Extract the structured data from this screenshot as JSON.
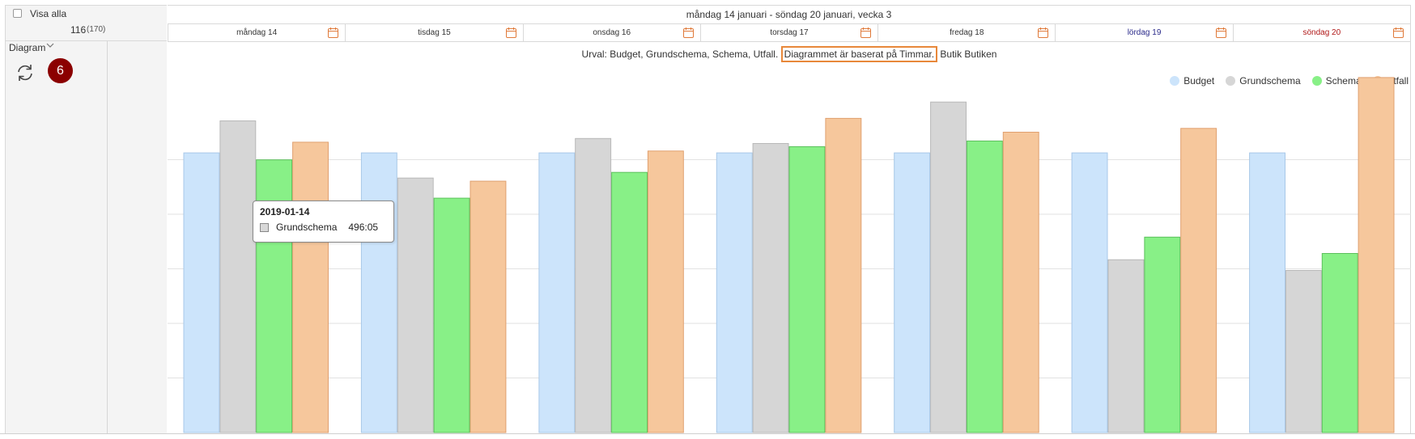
{
  "sidebar": {
    "show_all_label": "Visa alla",
    "count_main": "116",
    "count_total": "(170)",
    "diagram_label": "Diagram",
    "badge_count": "6"
  },
  "header": {
    "week_title": "måndag 14 januari - söndag 20 januari, vecka 3",
    "days": [
      {
        "label": "måndag 14",
        "type": "weekday"
      },
      {
        "label": "tisdag 15",
        "type": "weekday"
      },
      {
        "label": "onsdag 16",
        "type": "weekday"
      },
      {
        "label": "torsdag 17",
        "type": "weekday"
      },
      {
        "label": "fredag 18",
        "type": "weekday"
      },
      {
        "label": "lördag 19",
        "type": "sat"
      },
      {
        "label": "söndag 20",
        "type": "sun"
      }
    ]
  },
  "chart": {
    "subtitle_pre": "Urval: Budget, Grundschema, Schema, Utfall.",
    "subtitle_highlight": "Diagrammet är baserat på Timmar.",
    "subtitle_post": "Butik Butiken"
  },
  "tooltip": {
    "date": "2019-01-14",
    "series": "Grundschema",
    "value": "496:05"
  },
  "colors": {
    "budget": "#cce4fb",
    "grundschema": "#d6d6d6",
    "schema": "#88f087",
    "utfall": "#f6c79c",
    "badge": "#8b0000",
    "highlight": "#e8883a"
  },
  "chart_data": {
    "type": "bar",
    "categories": [
      "måndag 14",
      "tisdag 15",
      "onsdag 16",
      "torsdag 17",
      "fredag 18",
      "lördag 19",
      "söndag 20"
    ],
    "series": [
      {
        "name": "Budget",
        "color": "#cce4fb",
        "stroke": "#a8c8e8",
        "values": [
          445,
          445,
          445,
          445,
          445,
          445,
          445
        ]
      },
      {
        "name": "Grundschema",
        "color": "#d6d6d6",
        "stroke": "#b8b8b8",
        "values": [
          496,
          405,
          468,
          460,
          526,
          275,
          258
        ]
      },
      {
        "name": "Schema",
        "color": "#88f087",
        "stroke": "#5cc05c",
        "values": [
          434,
          373,
          414,
          455,
          464,
          311,
          285
        ]
      },
      {
        "name": "Utfall",
        "color": "#f6c79c",
        "stroke": "#e0a070",
        "values": [
          462,
          400,
          448,
          500,
          478,
          484,
          565
        ]
      }
    ],
    "ylim": [
      0,
      570
    ],
    "grid": true,
    "legend": "top-right",
    "tooltip_series_color": "#d6d6d6"
  }
}
